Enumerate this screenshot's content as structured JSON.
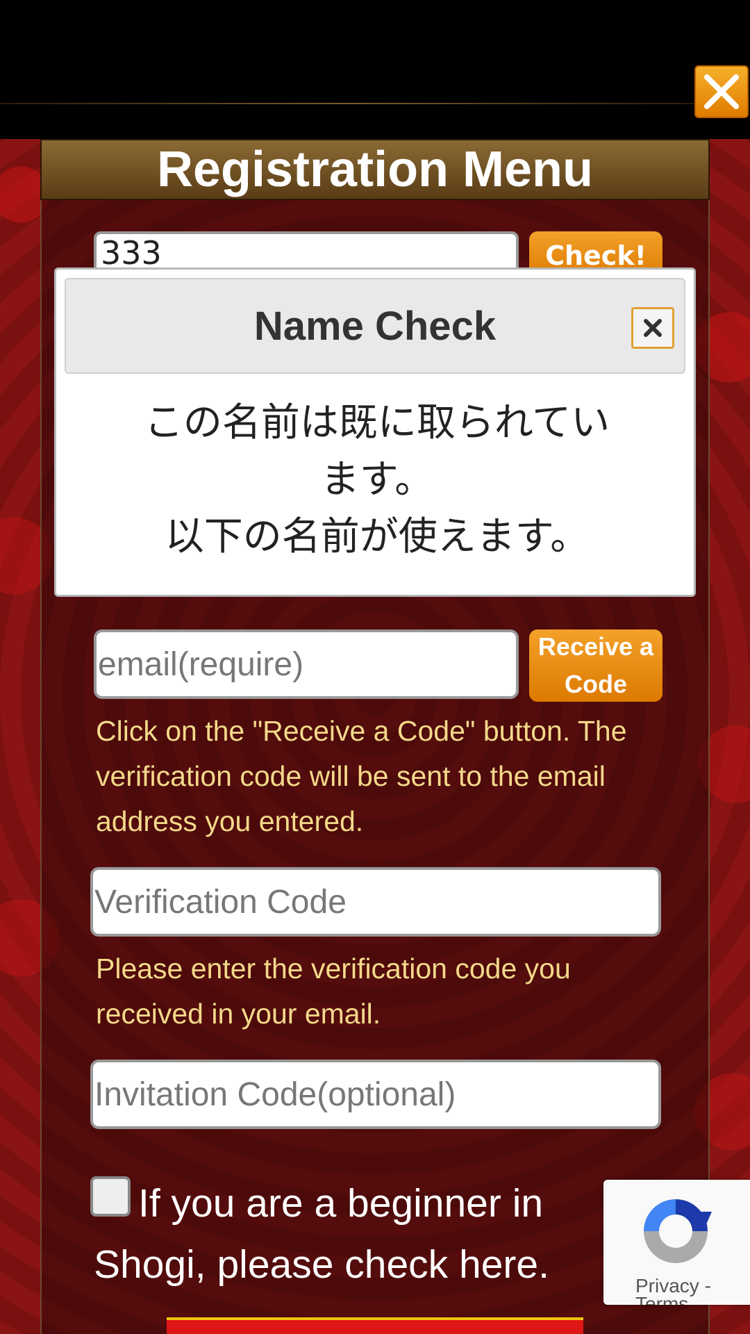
{
  "panel": {
    "title": "Registration Menu"
  },
  "name_field": {
    "value": "333",
    "check_label": "Check!"
  },
  "dialog": {
    "title": "Name Check",
    "message_line1": "この名前は既に取られてい",
    "message_line2": "ます。",
    "message_line3": "以下の名前が使えます。"
  },
  "email": {
    "placeholder": "email(require)",
    "button_line1": "Receive a",
    "button_line2": "Code",
    "help": "Click on the \"Receive a Code\" button. The verification code will be sent to the email address you entered."
  },
  "verification": {
    "placeholder": "Verification Code",
    "help": "Please enter the verification code you received in your email."
  },
  "invitation": {
    "placeholder": "Invitation Code(optional)"
  },
  "beginner": {
    "label": "If you are a beginner in Shogi, please check here.",
    "checked": false
  },
  "recaptcha": {
    "line1": "Privacy -",
    "line2": "Terms"
  },
  "colors": {
    "accent_orange": "#e8890c",
    "help_text": "#f4d98a",
    "background_red": "#7a1010"
  }
}
